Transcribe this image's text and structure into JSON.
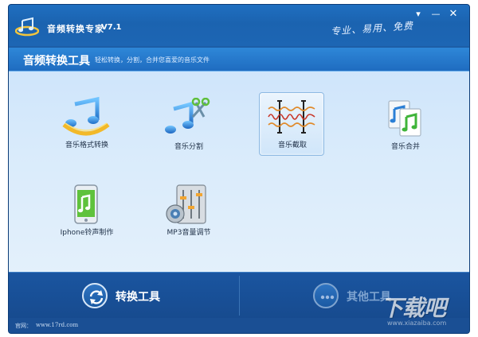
{
  "titlebar": {
    "title": "音频转换专家",
    "version": "V7.1",
    "slogan": "专业、易用、免费",
    "menu_glyph": "▾",
    "min_glyph": "—",
    "close_glyph": "✕"
  },
  "section": {
    "title": "音频转换工具",
    "description": "轻松转换，分割，合并您喜爱的音乐文件"
  },
  "tools": [
    {
      "label": "音乐格式转换",
      "icon": "music-convert-icon"
    },
    {
      "label": "音乐分割",
      "icon": "scissors-music-icon"
    },
    {
      "label": "音乐截取",
      "icon": "waveform-trim-icon",
      "selected": true
    },
    {
      "label": "音乐合并",
      "icon": "music-merge-icon"
    },
    {
      "label": "Iphone铃声制作",
      "icon": "phone-ringtone-icon"
    },
    {
      "label": "MP3音量调节",
      "icon": "volume-mixer-icon"
    }
  ],
  "bottom_nav": {
    "convert_label": "转换工具",
    "other_label": "其他工具"
  },
  "footer": {
    "site_label": "官网：",
    "site_url": "www.17rd.com"
  },
  "watermark": {
    "main": "下载吧",
    "sub": "www.xiazaiba.com"
  },
  "colors": {
    "accent": "#1d5fa8",
    "selected_border": "#8db9e2",
    "workspace": "#d9ebfb"
  }
}
